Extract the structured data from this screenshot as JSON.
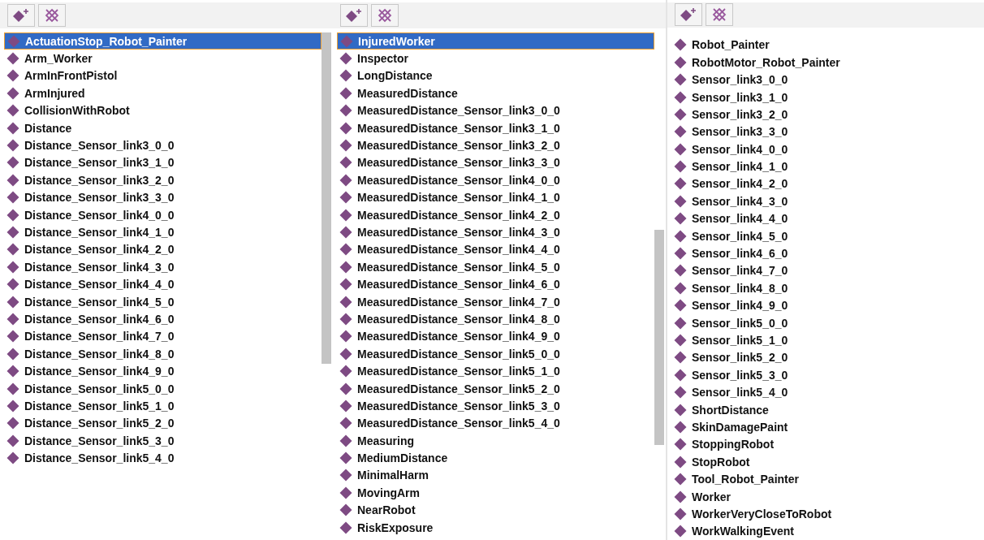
{
  "panels": [
    {
      "items": [
        {
          "label": "ActuationStop_Robot_Painter",
          "selected": true
        },
        {
          "label": "Arm_Worker",
          "selected": false
        },
        {
          "label": "ArmInFrontPistol",
          "selected": false
        },
        {
          "label": "ArmInjured",
          "selected": false
        },
        {
          "label": "CollisionWithRobot",
          "selected": false
        },
        {
          "label": "Distance",
          "selected": false
        },
        {
          "label": "Distance_Sensor_link3_0_0",
          "selected": false
        },
        {
          "label": "Distance_Sensor_link3_1_0",
          "selected": false
        },
        {
          "label": "Distance_Sensor_link3_2_0",
          "selected": false
        },
        {
          "label": "Distance_Sensor_link3_3_0",
          "selected": false
        },
        {
          "label": "Distance_Sensor_link4_0_0",
          "selected": false
        },
        {
          "label": "Distance_Sensor_link4_1_0",
          "selected": false
        },
        {
          "label": "Distance_Sensor_link4_2_0",
          "selected": false
        },
        {
          "label": "Distance_Sensor_link4_3_0",
          "selected": false
        },
        {
          "label": "Distance_Sensor_link4_4_0",
          "selected": false
        },
        {
          "label": "Distance_Sensor_link4_5_0",
          "selected": false
        },
        {
          "label": "Distance_Sensor_link4_6_0",
          "selected": false
        },
        {
          "label": "Distance_Sensor_link4_7_0",
          "selected": false
        },
        {
          "label": "Distance_Sensor_link4_8_0",
          "selected": false
        },
        {
          "label": "Distance_Sensor_link4_9_0",
          "selected": false
        },
        {
          "label": "Distance_Sensor_link5_0_0",
          "selected": false
        },
        {
          "label": "Distance_Sensor_link5_1_0",
          "selected": false
        },
        {
          "label": "Distance_Sensor_link5_2_0",
          "selected": false
        },
        {
          "label": "Distance_Sensor_link5_3_0",
          "selected": false
        },
        {
          "label": "Distance_Sensor_link5_4_0",
          "selected": false
        }
      ]
    },
    {
      "items": [
        {
          "label": "InjuredWorker",
          "selected": true
        },
        {
          "label": "Inspector",
          "selected": false
        },
        {
          "label": "LongDistance",
          "selected": false
        },
        {
          "label": "MeasuredDistance",
          "selected": false
        },
        {
          "label": "MeasuredDistance_Sensor_link3_0_0",
          "selected": false
        },
        {
          "label": "MeasuredDistance_Sensor_link3_1_0",
          "selected": false
        },
        {
          "label": "MeasuredDistance_Sensor_link3_2_0",
          "selected": false
        },
        {
          "label": "MeasuredDistance_Sensor_link3_3_0",
          "selected": false
        },
        {
          "label": "MeasuredDistance_Sensor_link4_0_0",
          "selected": false
        },
        {
          "label": "MeasuredDistance_Sensor_link4_1_0",
          "selected": false
        },
        {
          "label": "MeasuredDistance_Sensor_link4_2_0",
          "selected": false
        },
        {
          "label": "MeasuredDistance_Sensor_link4_3_0",
          "selected": false
        },
        {
          "label": "MeasuredDistance_Sensor_link4_4_0",
          "selected": false
        },
        {
          "label": "MeasuredDistance_Sensor_link4_5_0",
          "selected": false
        },
        {
          "label": "MeasuredDistance_Sensor_link4_6_0",
          "selected": false
        },
        {
          "label": "MeasuredDistance_Sensor_link4_7_0",
          "selected": false
        },
        {
          "label": "MeasuredDistance_Sensor_link4_8_0",
          "selected": false
        },
        {
          "label": "MeasuredDistance_Sensor_link4_9_0",
          "selected": false
        },
        {
          "label": "MeasuredDistance_Sensor_link5_0_0",
          "selected": false
        },
        {
          "label": "MeasuredDistance_Sensor_link5_1_0",
          "selected": false
        },
        {
          "label": "MeasuredDistance_Sensor_link5_2_0",
          "selected": false
        },
        {
          "label": "MeasuredDistance_Sensor_link5_3_0",
          "selected": false
        },
        {
          "label": "MeasuredDistance_Sensor_link5_4_0",
          "selected": false
        },
        {
          "label": "Measuring",
          "selected": false
        },
        {
          "label": "MediumDistance",
          "selected": false
        },
        {
          "label": "MinimalHarm",
          "selected": false
        },
        {
          "label": "MovingArm",
          "selected": false
        },
        {
          "label": "NearRobot",
          "selected": false
        },
        {
          "label": "RiskExposure",
          "selected": false
        }
      ]
    },
    {
      "items": [
        {
          "label": "Robot_Painter",
          "selected": false
        },
        {
          "label": "RobotMotor_Robot_Painter",
          "selected": false
        },
        {
          "label": "Sensor_link3_0_0",
          "selected": false
        },
        {
          "label": "Sensor_link3_1_0",
          "selected": false
        },
        {
          "label": "Sensor_link3_2_0",
          "selected": false
        },
        {
          "label": "Sensor_link3_3_0",
          "selected": false
        },
        {
          "label": "Sensor_link4_0_0",
          "selected": false
        },
        {
          "label": "Sensor_link4_1_0",
          "selected": false
        },
        {
          "label": "Sensor_link4_2_0",
          "selected": false
        },
        {
          "label": "Sensor_link4_3_0",
          "selected": false
        },
        {
          "label": "Sensor_link4_4_0",
          "selected": false
        },
        {
          "label": "Sensor_link4_5_0",
          "selected": false
        },
        {
          "label": "Sensor_link4_6_0",
          "selected": false
        },
        {
          "label": "Sensor_link4_7_0",
          "selected": false
        },
        {
          "label": "Sensor_link4_8_0",
          "selected": false
        },
        {
          "label": "Sensor_link4_9_0",
          "selected": false
        },
        {
          "label": "Sensor_link5_0_0",
          "selected": false
        },
        {
          "label": "Sensor_link5_1_0",
          "selected": false
        },
        {
          "label": "Sensor_link5_2_0",
          "selected": false
        },
        {
          "label": "Sensor_link5_3_0",
          "selected": false
        },
        {
          "label": "Sensor_link5_4_0",
          "selected": false
        },
        {
          "label": "ShortDistance",
          "selected": false
        },
        {
          "label": "SkinDamagePaint",
          "selected": false
        },
        {
          "label": "StoppingRobot",
          "selected": false
        },
        {
          "label": "StopRobot",
          "selected": false
        },
        {
          "label": "Tool_Robot_Painter",
          "selected": false
        },
        {
          "label": "Worker",
          "selected": false
        },
        {
          "label": "WorkerVeryCloseToRobot",
          "selected": false
        },
        {
          "label": "WorkWalkingEvent",
          "selected": false
        }
      ]
    }
  ]
}
